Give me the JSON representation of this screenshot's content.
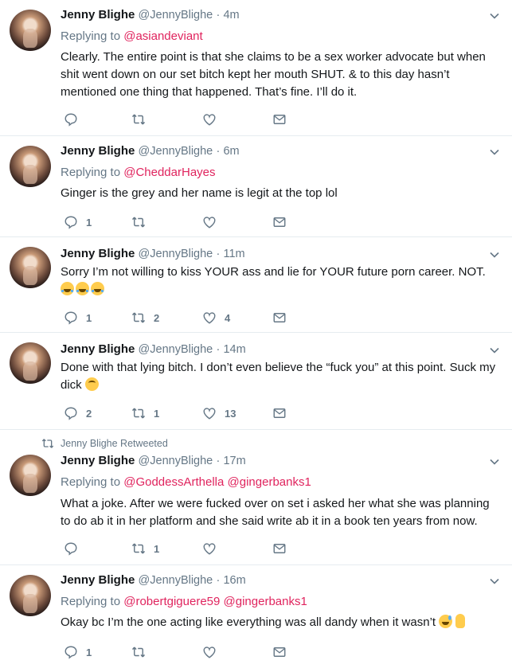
{
  "tweets": [
    {
      "name": "Jenny Blighe",
      "handle": "@JennyBlighe",
      "time": "4m",
      "replying_label": "Replying to",
      "replying_to": "@asiandeviant",
      "replying_to_2": "",
      "retweeted_by": "",
      "text": "Clearly. The entire point is that she claims to be a sex worker advocate but when shit went down on our set bitch kept her mouth SHUT. & to this day hasn’t mentioned one thing that happened. That’s fine. I’ll do it.",
      "replies": "",
      "retweets": "",
      "likes": ""
    },
    {
      "name": "Jenny Blighe",
      "handle": "@JennyBlighe",
      "time": "6m",
      "replying_label": "Replying to",
      "replying_to": "@CheddarHayes",
      "replying_to_2": "",
      "retweeted_by": "",
      "text": "Ginger is the grey and her name is legit at the top lol",
      "replies": "1",
      "retweets": "",
      "likes": ""
    },
    {
      "name": "Jenny Blighe",
      "handle": "@JennyBlighe",
      "time": "11m",
      "replying_label": "",
      "replying_to": "",
      "replying_to_2": "",
      "retweeted_by": "",
      "text": "Sorry I’m not willing to kiss YOUR ass and lie for YOUR future porn career. NOT.",
      "emoji": [
        "face-with-tears-of-joy",
        "face-with-tears-of-joy",
        "face-with-tears-of-joy"
      ],
      "replies": "1",
      "retweets": "2",
      "likes": "4"
    },
    {
      "name": "Jenny Blighe",
      "handle": "@JennyBlighe",
      "time": "14m",
      "replying_label": "",
      "replying_to": "",
      "replying_to_2": "",
      "retweeted_by": "",
      "text": "Done with that lying bitch. I don’t even believe the “fuck you” at this point. Suck my dick",
      "emoji": [
        "upside-down-face"
      ],
      "replies": "2",
      "retweets": "1",
      "likes": "13"
    },
    {
      "name": "Jenny Blighe",
      "handle": "@JennyBlighe",
      "time": "17m",
      "replying_label": "Replying to",
      "replying_to": "@GoddessArthella",
      "replying_to_2": "@gingerbanks1",
      "retweeted_by": "Jenny Blighe Retweeted",
      "text": "What a joke. After we were fucked over on set i asked her what she was planning to do ab it in her platform and she said write ab it in a book ten years from now.",
      "replies": "",
      "retweets": "1",
      "likes": ""
    },
    {
      "name": "Jenny Blighe",
      "handle": "@JennyBlighe",
      "time": "16m",
      "replying_label": "Replying to",
      "replying_to": "@robertgiguere59",
      "replying_to_2": "@gingerbanks1",
      "retweeted_by": "",
      "text": "Okay bc I’m the one acting like everything was all dandy when it wasn’t",
      "emoji": [
        "grinning-face-with-sweat",
        "ok-hand"
      ],
      "replies": "1",
      "retweets": "",
      "likes": ""
    }
  ],
  "icons": {
    "reply": "reply-icon",
    "retweet": "retweet-icon",
    "like": "heart-icon",
    "message": "envelope-icon",
    "menu": "chevron-down-icon"
  },
  "colors": {
    "mention": "#e0245e",
    "secondary_text": "#657786",
    "primary_text": "#14171a",
    "divider": "#e6ecf0"
  }
}
